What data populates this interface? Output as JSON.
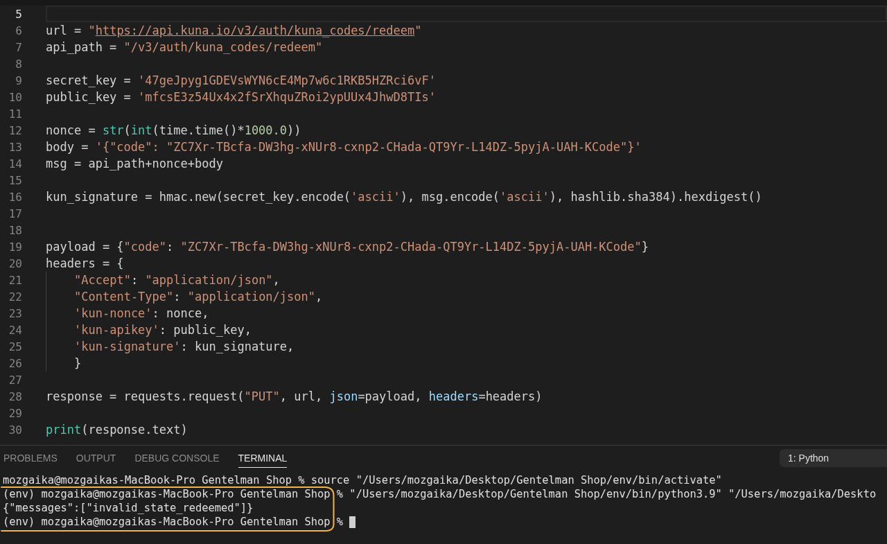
{
  "editor": {
    "lines": [
      {
        "number": "5",
        "active": true,
        "indented": false
      },
      {
        "number": "6",
        "active": false,
        "indented": false,
        "tokens": [
          {
            "text": "url = ",
            "kind": "plain"
          },
          {
            "text": "\"",
            "kind": "string"
          },
          {
            "text": "https://api.kuna.io/v3/auth/kuna_codes/redeem",
            "kind": "link"
          },
          {
            "text": "\"",
            "kind": "string"
          }
        ]
      },
      {
        "number": "7",
        "active": false,
        "indented": false,
        "tokens": [
          {
            "text": "api_path = ",
            "kind": "plain"
          },
          {
            "text": "\"/v3/auth/kuna_codes/redeem\"",
            "kind": "string"
          }
        ]
      },
      {
        "number": "8",
        "active": false,
        "indented": false
      },
      {
        "number": "9",
        "active": false,
        "indented": false,
        "tokens": [
          {
            "text": "secret_key = ",
            "kind": "plain"
          },
          {
            "text": "'47geJpyg1GDEVsWYN6cE4Mp7w6c1RKB5HZRci6vF'",
            "kind": "string"
          }
        ]
      },
      {
        "number": "10",
        "active": false,
        "indented": false,
        "tokens": [
          {
            "text": "public_key = ",
            "kind": "plain"
          },
          {
            "text": "'mfcsE3z54Ux4x2fSrXhquZRoi2ypUUx4JhwD8TIs'",
            "kind": "string"
          }
        ]
      },
      {
        "number": "11",
        "active": false,
        "indented": false
      },
      {
        "number": "12",
        "active": false,
        "indented": false,
        "tokens": [
          {
            "text": "nonce = ",
            "kind": "plain"
          },
          {
            "text": "str",
            "kind": "builtin"
          },
          {
            "text": "(",
            "kind": "plain"
          },
          {
            "text": "int",
            "kind": "builtin"
          },
          {
            "text": "(time.time()*",
            "kind": "plain"
          },
          {
            "text": "1000.0",
            "kind": "number"
          },
          {
            "text": "))",
            "kind": "plain"
          }
        ]
      },
      {
        "number": "13",
        "active": false,
        "indented": false,
        "tokens": [
          {
            "text": "body = ",
            "kind": "plain"
          },
          {
            "text": "'{\"code\": \"ZC7Xr-TBcfa-DW3hg-xNUr8-cxnp2-CHada-QT9Yr-L14DZ-5pyjA-UAH-KCode\"}'",
            "kind": "string"
          }
        ]
      },
      {
        "number": "14",
        "active": false,
        "indented": false,
        "tokens": [
          {
            "text": "msg = api_path+nonce+body",
            "kind": "plain"
          }
        ]
      },
      {
        "number": "15",
        "active": false,
        "indented": false
      },
      {
        "number": "16",
        "active": false,
        "indented": false,
        "tokens": [
          {
            "text": "kun_signature = hmac.new(secret_key.encode(",
            "kind": "plain"
          },
          {
            "text": "'ascii'",
            "kind": "string"
          },
          {
            "text": "), msg.encode(",
            "kind": "plain"
          },
          {
            "text": "'ascii'",
            "kind": "string"
          },
          {
            "text": "), hashlib.sha384).hexdigest()",
            "kind": "plain"
          }
        ]
      },
      {
        "number": "17",
        "active": false,
        "indented": false
      },
      {
        "number": "18",
        "active": false,
        "indented": false
      },
      {
        "number": "19",
        "active": false,
        "indented": false,
        "tokens": [
          {
            "text": "payload = {",
            "kind": "plain"
          },
          {
            "text": "\"code\"",
            "kind": "string"
          },
          {
            "text": ": ",
            "kind": "plain"
          },
          {
            "text": "\"ZC7Xr-TBcfa-DW3hg-xNUr8-cxnp2-CHada-QT9Yr-L14DZ-5pyjA-UAH-KCode\"",
            "kind": "string"
          },
          {
            "text": "}",
            "kind": "plain"
          }
        ]
      },
      {
        "number": "20",
        "active": false,
        "indented": false,
        "tokens": [
          {
            "text": "headers = {",
            "kind": "plain"
          }
        ]
      },
      {
        "number": "21",
        "active": false,
        "indented": true,
        "tokens": [
          {
            "text": "\"Accept\"",
            "kind": "string"
          },
          {
            "text": ": ",
            "kind": "plain"
          },
          {
            "text": "\"application/json\"",
            "kind": "string"
          },
          {
            "text": ",",
            "kind": "plain"
          }
        ]
      },
      {
        "number": "22",
        "active": false,
        "indented": true,
        "tokens": [
          {
            "text": "\"Content-Type\"",
            "kind": "string"
          },
          {
            "text": ": ",
            "kind": "plain"
          },
          {
            "text": "\"application/json\"",
            "kind": "string"
          },
          {
            "text": ",",
            "kind": "plain"
          }
        ]
      },
      {
        "number": "23",
        "active": false,
        "indented": true,
        "tokens": [
          {
            "text": "'kun-nonce'",
            "kind": "string"
          },
          {
            "text": ": nonce,",
            "kind": "plain"
          }
        ]
      },
      {
        "number": "24",
        "active": false,
        "indented": true,
        "tokens": [
          {
            "text": "'kun-apikey'",
            "kind": "string"
          },
          {
            "text": ": public_key,",
            "kind": "plain"
          }
        ]
      },
      {
        "number": "25",
        "active": false,
        "indented": true,
        "tokens": [
          {
            "text": "'kun-signature'",
            "kind": "string"
          },
          {
            "text": ": kun_signature,",
            "kind": "plain"
          }
        ]
      },
      {
        "number": "26",
        "active": false,
        "indented": true,
        "tokens": [
          {
            "text": "}",
            "kind": "plain"
          }
        ]
      },
      {
        "number": "27",
        "active": false,
        "indented": false
      },
      {
        "number": "28",
        "active": false,
        "indented": false,
        "tokens": [
          {
            "text": "response = requests.request(",
            "kind": "plain"
          },
          {
            "text": "\"PUT\"",
            "kind": "string"
          },
          {
            "text": ", url, ",
            "kind": "plain"
          },
          {
            "text": "json",
            "kind": "param"
          },
          {
            "text": "=payload, ",
            "kind": "plain"
          },
          {
            "text": "headers",
            "kind": "param"
          },
          {
            "text": "=headers)",
            "kind": "plain"
          }
        ]
      },
      {
        "number": "29",
        "active": false,
        "indented": false
      },
      {
        "number": "30",
        "active": false,
        "indented": false,
        "tokens": [
          {
            "text": "print",
            "kind": "builtin"
          },
          {
            "text": "(response.text)",
            "kind": "plain"
          }
        ]
      }
    ]
  },
  "panel": {
    "tabs": [
      {
        "label": "PROBLEMS",
        "selected": false
      },
      {
        "label": "OUTPUT",
        "selected": false
      },
      {
        "label": "DEBUG CONSOLE",
        "selected": false
      },
      {
        "label": "TERMINAL",
        "selected": true
      }
    ],
    "terminal_picker": "1: Python",
    "terminal_lines": [
      {
        "text": "mozgaika@mozgaikas-MacBook-Pro Gentelman Shop % source \"/Users/mozgaika/Desktop/Gentelman Shop/env/bin/activate\""
      },
      {
        "text": "(env) mozgaika@mozgaikas-MacBook-Pro Gentelman Shop % \"/Users/mozgaika/Desktop/Gentelman Shop/env/bin/python3.9\" \"/Users/mozgaika/Deskto"
      },
      {
        "text": "{\"messages\":[\"invalid_state_redeemed\"]}"
      },
      {
        "text": "(env) mozgaika@mozgaikas-MacBook-Pro Gentelman Shop %"
      }
    ]
  }
}
